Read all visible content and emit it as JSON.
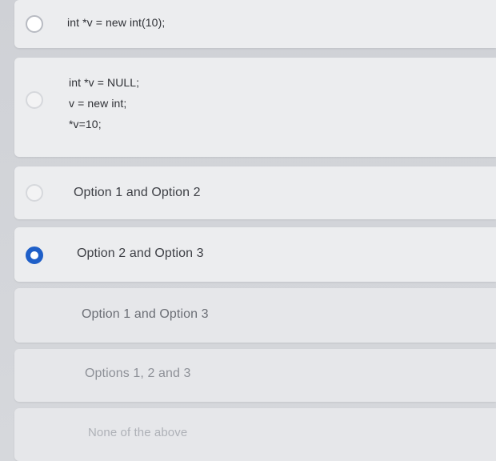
{
  "question": {
    "options": [
      {
        "id": "opt-1",
        "lines": [
          "int *v = new int(10);"
        ],
        "selected": false
      },
      {
        "id": "opt-2",
        "lines": [
          "int *v = NULL;",
          "v = new int;",
          "*v=10;"
        ],
        "selected": false
      },
      {
        "id": "opt-3",
        "lines": [
          "Option 1 and Option 2"
        ],
        "selected": false
      },
      {
        "id": "opt-4",
        "lines": [
          "Option 2 and Option 3"
        ],
        "selected": true
      },
      {
        "id": "opt-5",
        "lines": [
          "Option 1 and Option 3"
        ],
        "selected": false
      },
      {
        "id": "opt-6",
        "lines": [
          "Options 1, 2 and 3"
        ],
        "selected": false
      },
      {
        "id": "opt-7",
        "lines": [
          "None of the above"
        ],
        "selected": false
      }
    ]
  },
  "colors": {
    "accent": "#1f5fc8",
    "card": "#ecedef",
    "background": "#d3d5da"
  }
}
